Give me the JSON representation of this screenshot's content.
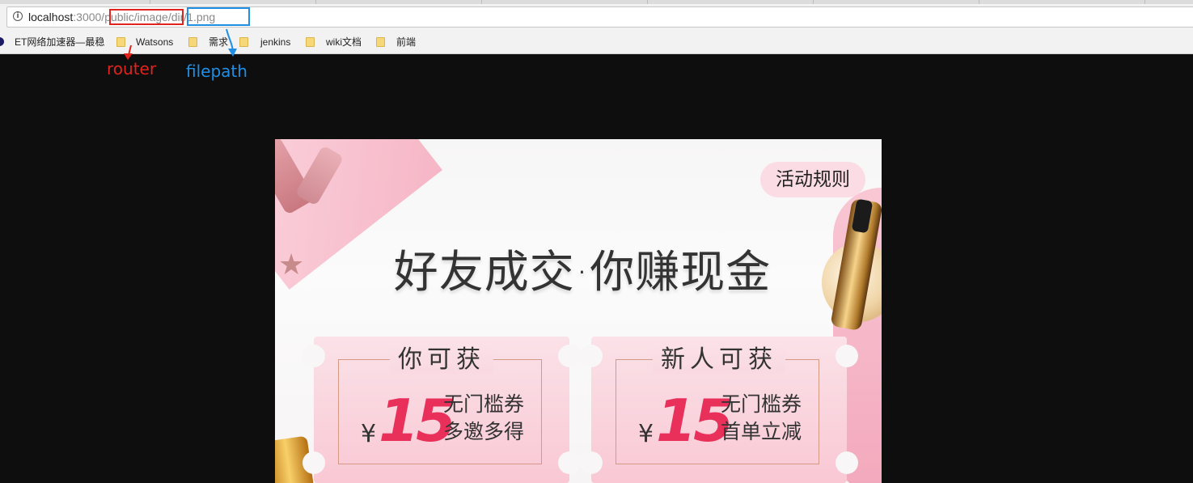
{
  "browser": {
    "url_host": "localhost",
    "url_rest_a": ":3000/",
    "url_router": "public/image",
    "url_sep": "/",
    "url_filepath": "dir/1.png",
    "bookmarks": [
      "ET网络加速器—最稳",
      "Watsons",
      "需求",
      "",
      "jenkins",
      "wiki文档",
      "前端"
    ]
  },
  "annotations": {
    "router_label": "router",
    "filepath_label": "filepath",
    "router_color": "#e0231c",
    "filepath_color": "#1f8fe6"
  },
  "poster": {
    "rules_button": "活动规则",
    "headline": "好友成交·你赚现金",
    "cards": [
      {
        "title": "你可获",
        "currency": "¥",
        "amount": "15",
        "line1": "无门槛券",
        "line2": "多邀多得"
      },
      {
        "title": "新人可获",
        "currency": "¥",
        "amount": "15",
        "line1": "无门槛券",
        "line2": "首单立减"
      }
    ],
    "accent_color": "#e8305a"
  }
}
